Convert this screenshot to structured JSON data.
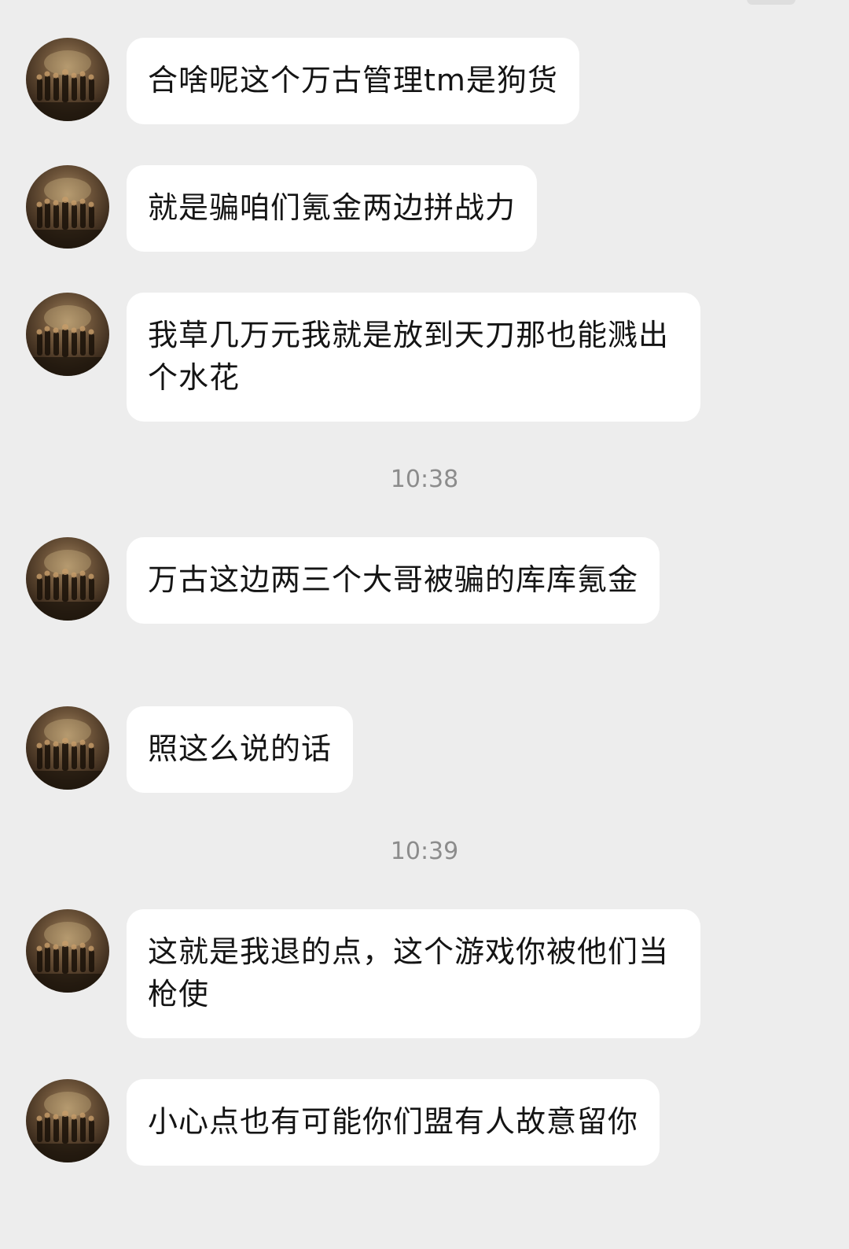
{
  "chat": {
    "messages": [
      {
        "text": "合啥呢这个万古管理tm是狗货"
      },
      {
        "text": "就是骗咱们氪金两边拼战力"
      },
      {
        "text": "我草几万元我就是放到天刀那也能溅出个水花"
      },
      {
        "time": "10:38"
      },
      {
        "text": "万古这边两三个大哥被骗的库库氪金"
      },
      {
        "text": "照这么说的话"
      },
      {
        "time": "10:39"
      },
      {
        "text": "这就是我退的点，这个游戏你被他们当枪使"
      },
      {
        "text": "小心点也有可能你们盟有人故意留你"
      }
    ]
  },
  "theme": {
    "background": "#ededed",
    "bubble": "#ffffff",
    "text": "#141414",
    "timestamp": "#8c8c8c"
  },
  "icons": {
    "avatar": "avatar-photo-icon"
  }
}
